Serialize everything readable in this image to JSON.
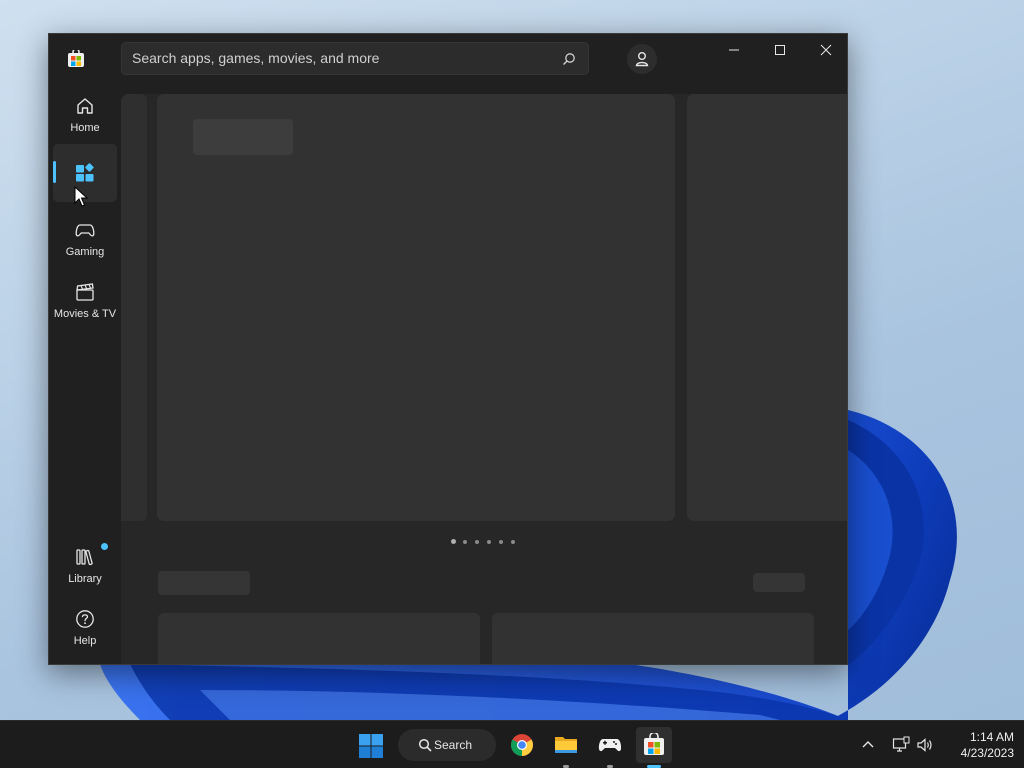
{
  "window": {
    "search_placeholder": "Search apps, games, movies, and more"
  },
  "sidebar": {
    "items": [
      {
        "label": "Home",
        "icon": "home-icon"
      },
      {
        "label": "",
        "icon": "apps-icon",
        "selected": true
      },
      {
        "label": "Gaming",
        "icon": "gamepad-icon"
      },
      {
        "label": "Movies & TV",
        "icon": "clapperboard-icon"
      },
      {
        "label": "Library",
        "icon": "library-icon",
        "badge": true
      },
      {
        "label": "Help",
        "icon": "help-icon"
      }
    ]
  },
  "carousel": {
    "page_count": 6,
    "active_index": 0
  },
  "taskbar": {
    "search_label": "Search",
    "apps": [
      "chrome",
      "file-explorer",
      "game",
      "microsoft-store"
    ],
    "time": "1:14 AM",
    "date": "4/23/2023"
  },
  "colors": {
    "accent": "#4cc2ff",
    "window_bg": "#202020",
    "taskbar_bg": "#1c1c1c"
  }
}
